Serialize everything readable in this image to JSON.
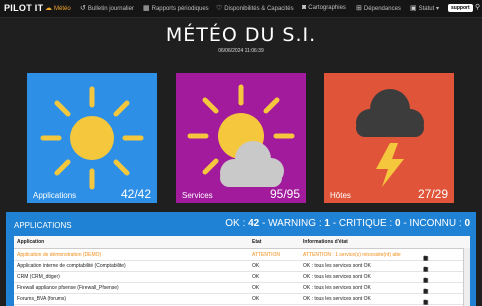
{
  "nav": {
    "brand": "PILOT IT",
    "items": [
      {
        "label": "Météo",
        "icon": "weather-icon"
      },
      {
        "label": "Bulletin journalier",
        "icon": "history-icon"
      },
      {
        "label": "Rapports périodiques",
        "icon": "calendar-icon"
      },
      {
        "label": "Disponibilités & Capacités",
        "icon": "heart-icon"
      },
      {
        "label": "Cartographies",
        "icon": "camera-icon"
      },
      {
        "label": "Dépendances",
        "icon": "sitemap-icon"
      },
      {
        "label": "Statut",
        "icon": "status-icon"
      }
    ],
    "support": "support"
  },
  "header": {
    "title": "MÉTÉO DU S.I.",
    "datetime": "06/06/2024 11:06:39"
  },
  "cards": [
    {
      "label": "Applications",
      "count": "42/42",
      "color": "#2e8fe6",
      "icon": "sun-icon"
    },
    {
      "label": "Services",
      "count": "95/95",
      "color": "#a21b9d",
      "icon": "sun-cloud-icon"
    },
    {
      "label": "Hôtes",
      "count": "27/29",
      "color": "#e0553a",
      "icon": "storm-icon"
    }
  ],
  "panel": {
    "title": "APPLICATIONS",
    "ok_label": "OK :",
    "ok": "42",
    "warning_label": "- WARNING :",
    "warning": "1",
    "critique_label": "- CRITIQUE :",
    "critique": "0",
    "inconnu_label": "- INCONNU :",
    "inconnu": "0"
  },
  "table": {
    "headers": [
      "Application",
      "Etat",
      "Informations d'état"
    ],
    "rows": [
      {
        "app": "Application de démonstration (DEMO)",
        "etat": "ATTENTION",
        "info": "ATTENTION : 1 service(s) nécessite(nt) atte",
        "warn": true
      },
      {
        "app": "Application interne de comptabilité (Comptabilite)",
        "etat": "OK",
        "info": "OK : tous les services sont OK",
        "warn": false
      },
      {
        "app": "CRM (CRM_dtiger)",
        "etat": "OK",
        "info": "OK : tous les services sont OK",
        "warn": false
      },
      {
        "app": "Firewall appliance pfsense (Firewall_Pfsense)",
        "etat": "OK",
        "info": "OK : tous les services sont OK",
        "warn": false
      },
      {
        "app": "Forums_BVA (forums)",
        "etat": "OK",
        "info": "OK : tous les services sont OK",
        "warn": false
      }
    ]
  }
}
